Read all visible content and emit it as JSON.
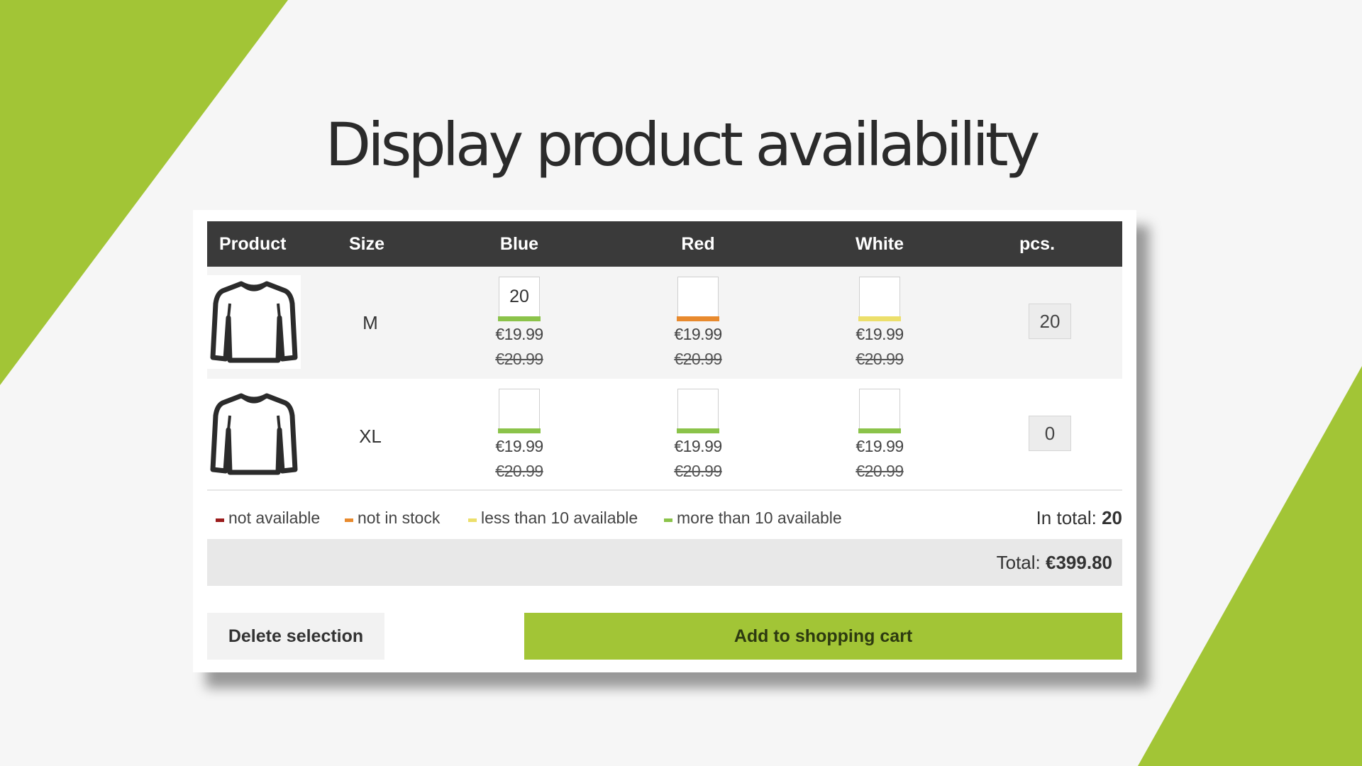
{
  "page": {
    "title": "Display product availability",
    "accent_color": "#a2c536"
  },
  "table": {
    "headers": {
      "product": "Product",
      "size": "Size",
      "blue": "Blue",
      "red": "Red",
      "white": "White",
      "pcs": "pcs."
    },
    "rows": [
      {
        "product_icon": "long-sleeve-shirt-icon",
        "size": "M",
        "blue": {
          "qty": "20",
          "availability": "more than 10 available",
          "bar_color": "#8bc34a",
          "price": "€19.99",
          "old_price": "€20.99"
        },
        "red": {
          "qty": "",
          "availability": "not in stock",
          "bar_color": "#e88a2e",
          "price": "€19.99",
          "old_price": "€20.99"
        },
        "white": {
          "qty": "",
          "availability": "less than 10 available",
          "bar_color": "#ecdf6b",
          "price": "€19.99",
          "old_price": "€20.99"
        },
        "pcs": "20"
      },
      {
        "product_icon": "long-sleeve-shirt-icon",
        "size": "XL",
        "blue": {
          "qty": "",
          "availability": "more than 10 available",
          "bar_color": "#8bc34a",
          "price": "€19.99",
          "old_price": "€20.99"
        },
        "red": {
          "qty": "",
          "availability": "more than 10 available",
          "bar_color": "#8bc34a",
          "price": "€19.99",
          "old_price": "€20.99"
        },
        "white": {
          "qty": "",
          "availability": "more than 10 available",
          "bar_color": "#8bc34a",
          "price": "€19.99",
          "old_price": "€20.99"
        },
        "pcs": "0"
      }
    ]
  },
  "legend": [
    {
      "label": "not available",
      "color": "#9b1c1c"
    },
    {
      "label": "not in stock",
      "color": "#e88a2e"
    },
    {
      "label": "less than 10 available",
      "color": "#ecdf6b"
    },
    {
      "label": "more than 10 available",
      "color": "#8bc34a"
    }
  ],
  "summary": {
    "in_total_label": "In total:",
    "in_total_value": "20",
    "total_label": "Total:",
    "total_value": "€399.80"
  },
  "actions": {
    "delete_label": "Delete selection",
    "cart_label": "Add to shopping cart"
  }
}
